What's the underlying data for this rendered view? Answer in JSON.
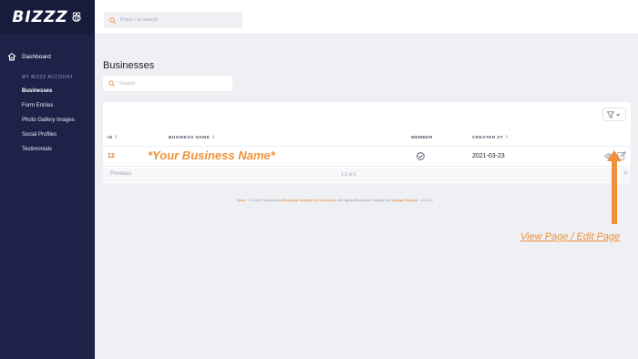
{
  "brand": {
    "name": "BIZZZ"
  },
  "search": {
    "placeholder": "Press / to search"
  },
  "sidebar": {
    "dashboard": "Dashboard",
    "section": "MY BIZZZ ACCOUNT",
    "items": [
      {
        "label": "Businesses"
      },
      {
        "label": "Form Entries"
      },
      {
        "label": "Photo Gallery Images"
      },
      {
        "label": "Social Profiles"
      },
      {
        "label": "Testimonials"
      }
    ]
  },
  "page": {
    "title": "Businesses",
    "search_placeholder": "Search"
  },
  "table": {
    "columns": [
      "ID",
      "BUSINESS NAME",
      "MEMBER",
      "CREATED AT"
    ],
    "rows": [
      {
        "id": "12",
        "name": "*Your Business Name*",
        "member": "check-circle-icon",
        "created": "2021-03-23"
      }
    ],
    "pagination": {
      "previous": "Previous",
      "page_info": "1-1 of 1",
      "next": "rt"
    }
  },
  "footer": {
    "brand": "Bizzz",
    "text_1": " · © 2021 Powered by ",
    "org": "Winnipeg Chamber of Commerce",
    "text_2": ". All Rights Reserved. Website by ",
    "studio": "Vantage Studios",
    "version": " · v3.22.0"
  },
  "annotation": {
    "label": "View Page / Edit Page"
  },
  "colors": {
    "sidebar": "#1d2248",
    "accent": "#f0913a",
    "id": "#e07a2a"
  }
}
